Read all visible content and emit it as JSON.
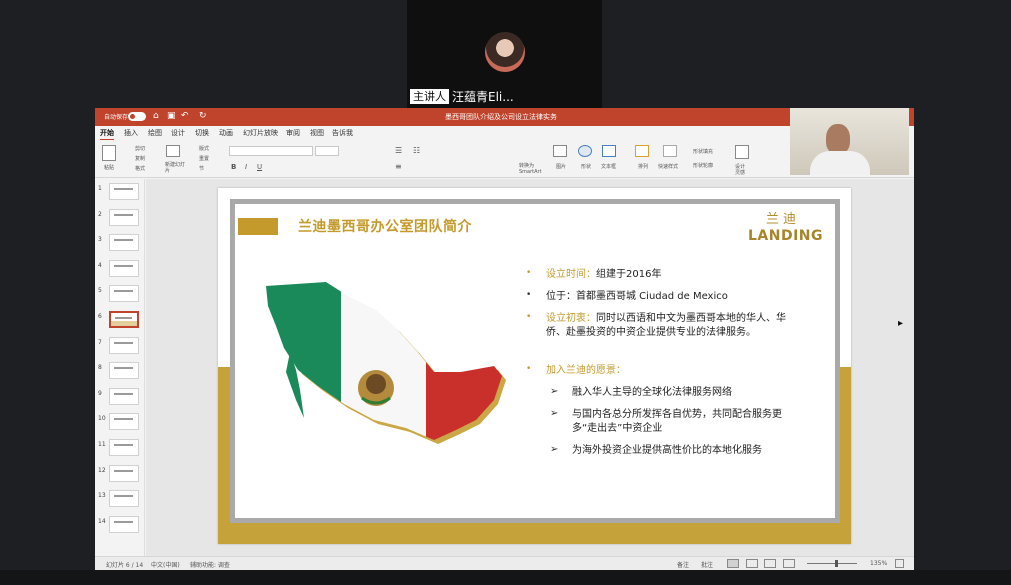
{
  "presenter": {
    "role": "主讲人",
    "name": "汪蕴青Eli..."
  },
  "window": {
    "autosave": "自动保存",
    "doc_title": "墨西哥团队介绍及公司设立法律实务",
    "tabs": [
      "开始",
      "插入",
      "绘图",
      "设计",
      "切换",
      "动画",
      "幻灯片放映",
      "审阅",
      "视图",
      "告诉我"
    ]
  },
  "ribbon": {
    "paste": "粘贴",
    "cut": "剪切",
    "copy": "复制",
    "format": "格式",
    "new_slide": "新建幻灯片",
    "layout": "版式",
    "reset": "重置",
    "section": "节",
    "convert": "转换为SmartArt",
    "picture": "图片",
    "shapes": "形状",
    "textbox": "文本框",
    "arrange": "排列",
    "quick_styles": "快速样式",
    "shape_fill": "形状填充",
    "shape_outline": "形状轮廓",
    "designer": "设计灵感"
  },
  "thumbs": {
    "count": 14,
    "selected": 6
  },
  "slide": {
    "title": "兰迪墨西哥办公室团队简介",
    "logo_cn": "兰迪",
    "logo_en": "LANDING",
    "bullets": [
      {
        "label": "设立时间：",
        "text": "组建于2016年"
      },
      {
        "label": "",
        "text": "位于：首都墨西哥城 Ciudad de Mexico"
      },
      {
        "label": "设立初衷：",
        "text": "同时以西语和中文为墨西哥本地的华人、华侨、赴墨投资的中资企业提供专业的法律服务。"
      },
      {
        "label": "加入兰迪的愿景：",
        "text": ""
      }
    ],
    "sub_items": [
      "融入华人主导的全球化法律服务网络",
      "与国内各总分所发挥各自优势，共同配合服务更多“走出去”中资企业",
      "为海外投资企业提供高性价比的本地化服务"
    ]
  },
  "status": {
    "slide_pos": "幻灯片 6 / 14",
    "lang": "中文(中国)",
    "accessibility": "辅助功能: 调查",
    "notes": "备注",
    "comments": "批注",
    "zoom": "135%"
  }
}
